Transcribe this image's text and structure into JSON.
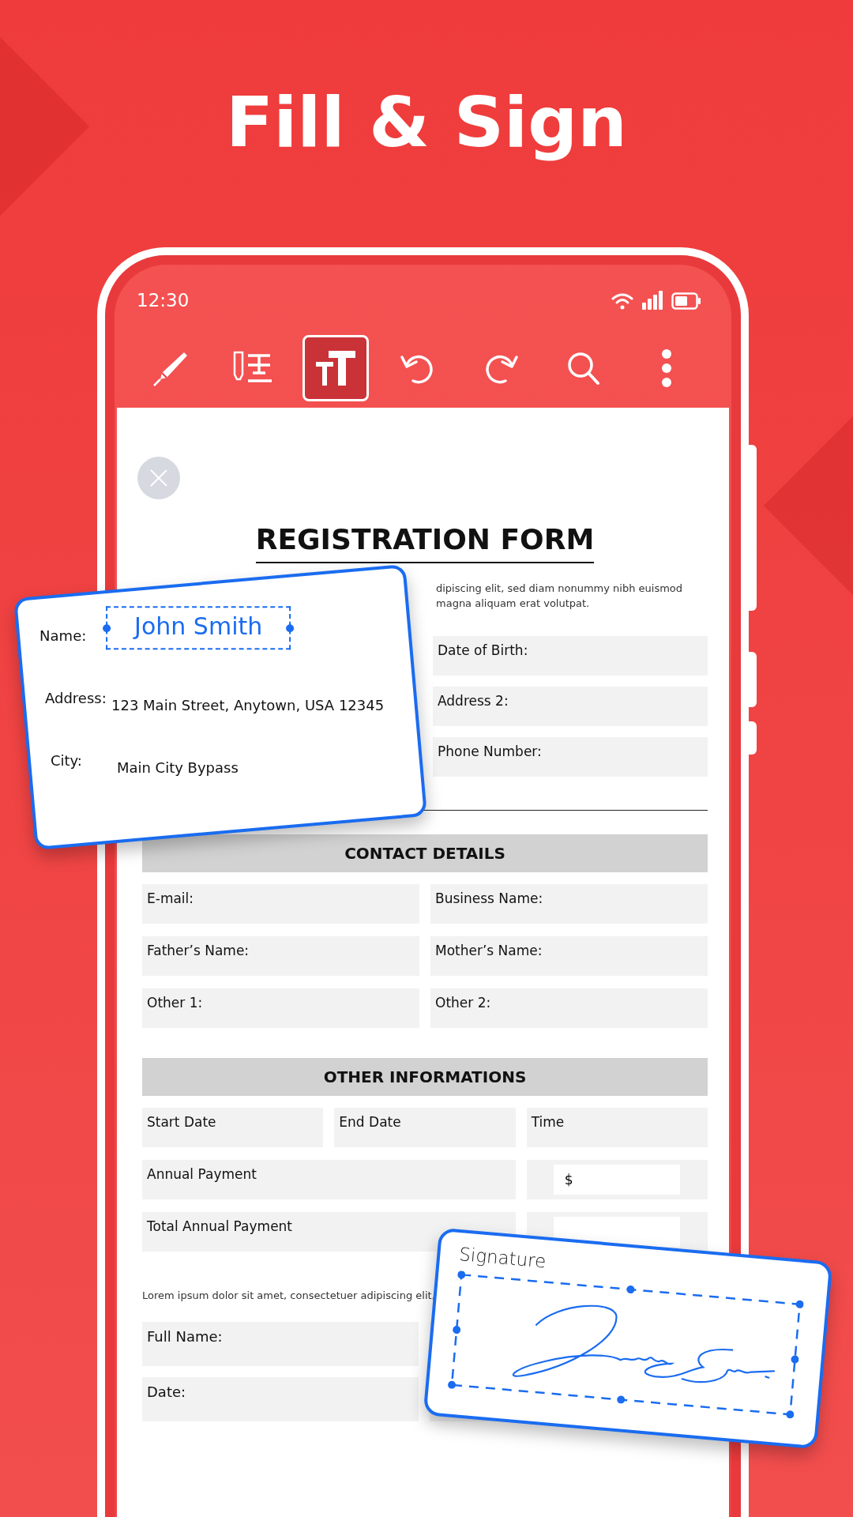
{
  "headline": "Fill & Sign",
  "status_bar": {
    "time": "12:30"
  },
  "toolbar": {
    "tools": [
      {
        "kind": "pen",
        "selected": false
      },
      {
        "kind": "text-field",
        "selected": false
      },
      {
        "kind": "text-size",
        "selected": true
      },
      {
        "kind": "undo",
        "selected": false
      },
      {
        "kind": "redo",
        "selected": false
      },
      {
        "kind": "search",
        "selected": false
      },
      {
        "kind": "more",
        "selected": false
      }
    ]
  },
  "document": {
    "title": "REGISTRATION FORM",
    "intro": "dipiscing elit, sed diam nonummy nibh euismod magna aliquam erat volutpat.",
    "personal_fields": [
      "Date of Birth:",
      "Address 2:",
      "Phone Number:"
    ],
    "sections": [
      {
        "title": "CONTACT DETAILS",
        "rows": [
          [
            {
              "kind": "label",
              "label": "E-mail:"
            },
            {
              "kind": "label",
              "label": "Business Name:"
            }
          ],
          [
            {
              "kind": "label",
              "label": "Father’s Name:"
            },
            {
              "kind": "label",
              "label": "Mother’s Name:"
            }
          ],
          [
            {
              "kind": "label",
              "label": "Other 1:"
            },
            {
              "kind": "label",
              "label": "Other 2:"
            }
          ]
        ]
      },
      {
        "title": "OTHER INFORMATIONS",
        "rows": [
          [
            {
              "kind": "label",
              "label": "Start Date"
            },
            {
              "kind": "label",
              "label": "End Date"
            },
            {
              "kind": "label",
              "label": "Time"
            }
          ],
          [
            {
              "kind": "label",
              "label": "Annual Payment"
            },
            {
              "kind": "amount",
              "value": "$"
            }
          ],
          [
            {
              "kind": "label",
              "label": "Total Annual Payment"
            },
            {
              "kind": "amount"
            }
          ]
        ]
      }
    ],
    "footer_text": "Lorem ipsum dolor sit amet, consectetuer adipiscing elit,",
    "signer_fields": [
      "Full Name:",
      "Date:"
    ]
  },
  "name_card": {
    "fields": [
      {
        "label": "Name:",
        "value": "John Smith",
        "selected": true
      },
      {
        "label": "Address:",
        "value": "123 Main Street, Anytown, USA 12345",
        "selected": false
      },
      {
        "label": "City:",
        "value": "Main City Bypass",
        "selected": false
      }
    ]
  },
  "signature_card": {
    "label": "Signature"
  }
}
